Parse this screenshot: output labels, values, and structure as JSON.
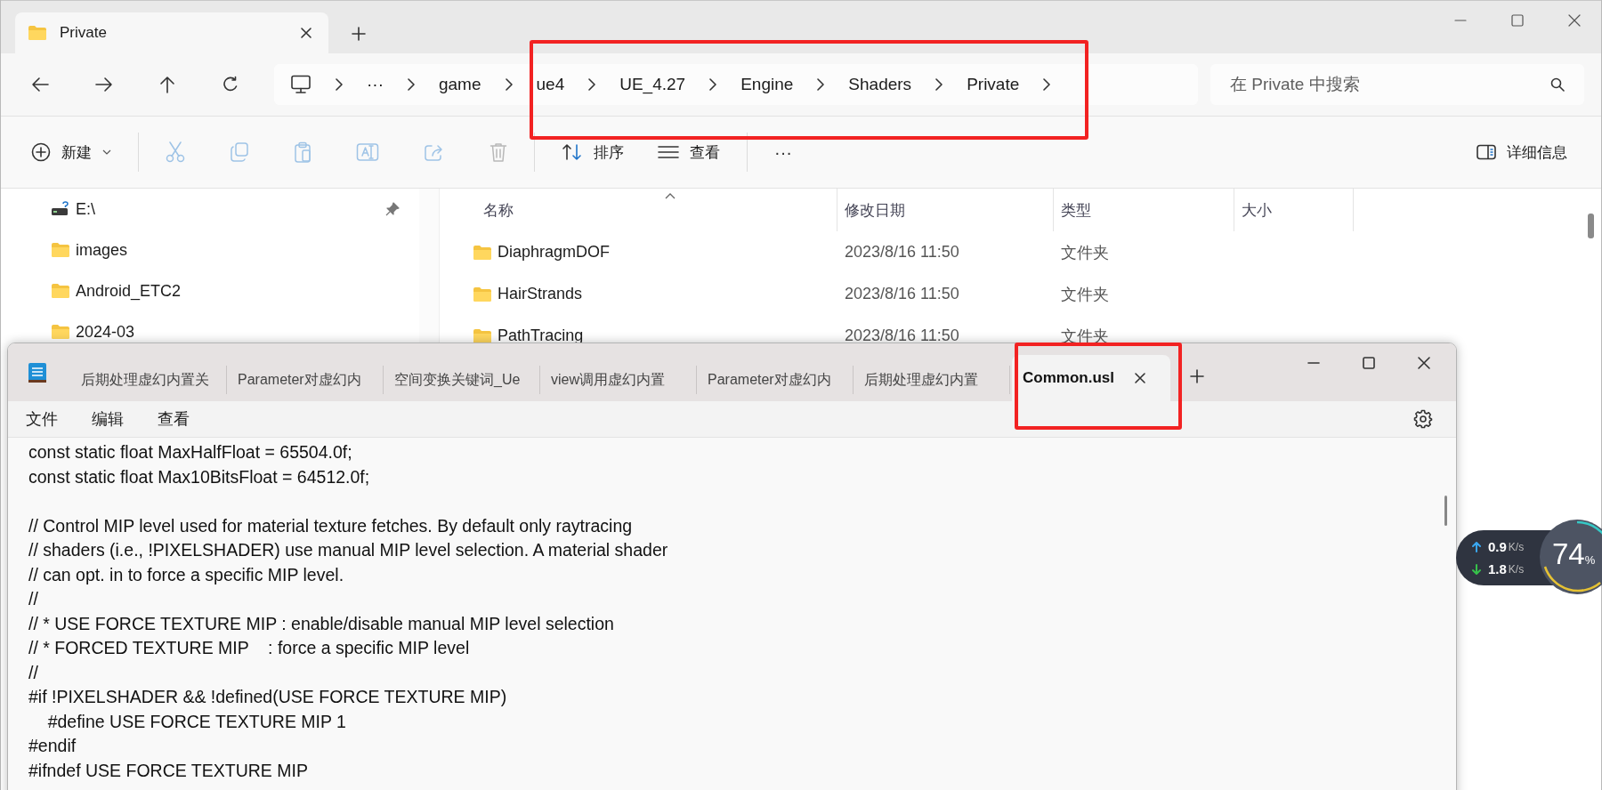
{
  "explorer": {
    "tabs": [
      {
        "label": "Private",
        "selected": true
      }
    ],
    "breadcrumb_overflow": "···",
    "breadcrumb": [
      "game",
      "ue4",
      "UE_4.27",
      "Engine",
      "Shaders",
      "Private"
    ],
    "search": {
      "placeholder": "在 Private 中搜索"
    },
    "toolbar": {
      "new": "新建",
      "sort": "排序",
      "view": "查看",
      "more": "···",
      "details": "详细信息"
    },
    "sidebar": {
      "items": [
        {
          "label": "E:\\",
          "kind": "drive",
          "pinned": true
        },
        {
          "label": "images",
          "kind": "folder",
          "pinned": false
        },
        {
          "label": "Android_ETC2",
          "kind": "folder",
          "pinned": false
        },
        {
          "label": "2024-03",
          "kind": "folder",
          "pinned": false
        }
      ]
    },
    "table": {
      "columns": [
        "名称",
        "修改日期",
        "类型",
        "大小"
      ],
      "rows": [
        {
          "name": "DiaphragmDOF",
          "modified": "2023/8/16 11:50",
          "type": "文件夹"
        },
        {
          "name": "HairStrands",
          "modified": "2023/8/16 11:50",
          "type": "文件夹"
        },
        {
          "name": "PathTracing",
          "modified": "2023/8/16 11:50",
          "type": "文件夹"
        }
      ]
    }
  },
  "notepad": {
    "tabs": [
      {
        "label": "后期处理虚幻内置关",
        "selected": false
      },
      {
        "label": "Parameter对虚幻内",
        "selected": false
      },
      {
        "label": "空间变换关键词_Ue",
        "selected": false
      },
      {
        "label": "view调用虚幻内置",
        "selected": false
      },
      {
        "label": "Parameter对虚幻内",
        "selected": false
      },
      {
        "label": "后期处理虚幻内置",
        "selected": false
      },
      {
        "label": "Common.usl",
        "selected": true
      }
    ],
    "menu": [
      "文件",
      "编辑",
      "查看"
    ],
    "text": "const static float MaxHalfFloat = 65504.0f;\nconst static float Max10BitsFloat = 64512.0f;\n\n// Control MIP level used for material texture fetches. By default only raytracing\n// shaders (i.e., !PIXELSHADER) use manual MIP level selection. A material shader\n// can opt. in to force a specific MIP level.\n//\n// * USE FORCE TEXTURE MIP : enable/disable manual MIP level selection\n// * FORCED TEXTURE MIP    : force a specific MIP level\n//\n#if !PIXELSHADER && !defined(USE FORCE TEXTURE MIP)\n\t#define USE FORCE TEXTURE MIP 1\n#endif\n#ifndef USE FORCE TEXTURE MIP"
  },
  "net_widget": {
    "upload": "0.9",
    "upload_unit": "K/s",
    "download": "1.8",
    "download_unit": "K/s",
    "percent": "74",
    "percent_sign": "%"
  },
  "highlights": {
    "address_bar": true,
    "active_tab": true
  }
}
